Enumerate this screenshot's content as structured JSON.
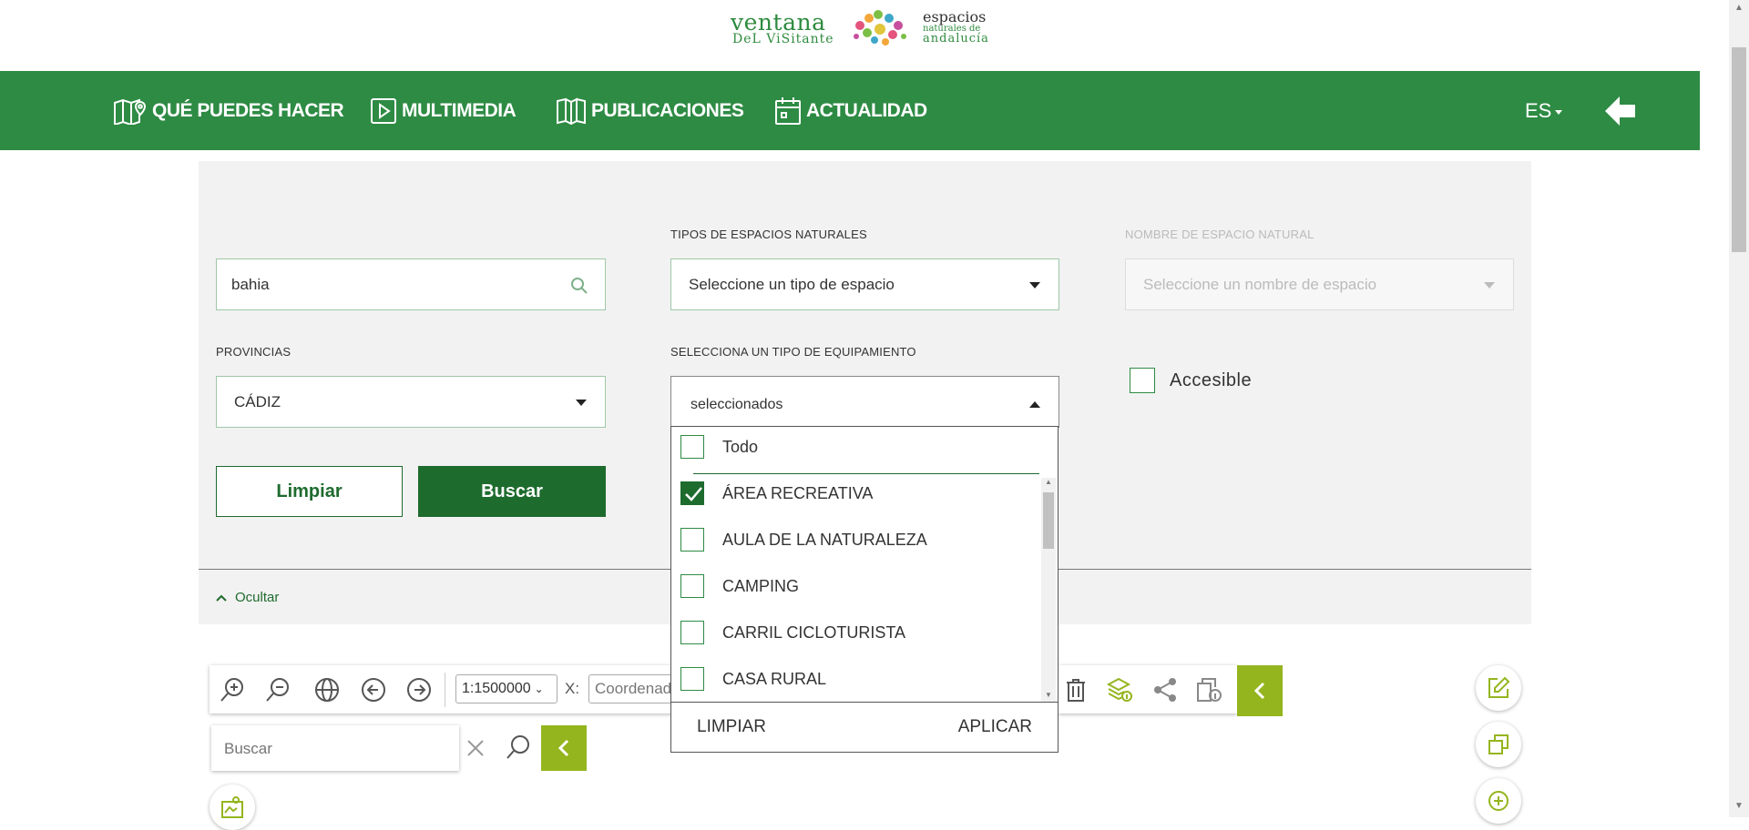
{
  "logo": {
    "left_line1": "ventana",
    "left_line2": "DeL ViSitante",
    "right_line1": "espacios",
    "right_line2": "naturales de",
    "right_line3": "andalucía"
  },
  "nav": {
    "items": [
      {
        "label": "QUÉ PUEDES HACER",
        "icon": "map-pin-icon"
      },
      {
        "label": "MULTIMEDIA",
        "icon": "play-icon"
      },
      {
        "label": "PUBLICACIONES",
        "icon": "book-icon"
      },
      {
        "label": "ACTUALIDAD",
        "icon": "calendar-icon"
      }
    ],
    "language": "ES",
    "back_icon": "arrow-left-icon"
  },
  "filters": {
    "search_value": "bahia",
    "tipos_label": "TIPOS DE ESPACIOS NATURALES",
    "tipos_placeholder": "Seleccione un tipo de espacio",
    "nombre_label": "NOMBRE DE ESPACIO NATURAL",
    "nombre_placeholder": "Seleccione un nombre de espacio",
    "provincias_label": "PROVINCIAS",
    "provincia_value": "CÁDIZ",
    "equipamiento_label": "SELECCIONA UN TIPO DE EQUIPAMIENTO",
    "equipamiento_value": "seleccionados",
    "accesible_label": "Accesible",
    "accesible_checked": false,
    "limpiar_label": "Limpiar",
    "buscar_label": "Buscar",
    "ocultar_label": "Ocultar"
  },
  "dropdown": {
    "todo_label": "Todo",
    "items": [
      {
        "label": "ÁREA RECREATIVA",
        "checked": true
      },
      {
        "label": "AULA DE LA NATURALEZA",
        "checked": false
      },
      {
        "label": "CAMPING",
        "checked": false
      },
      {
        "label": "CARRIL CICLOTURISTA",
        "checked": false
      },
      {
        "label": "CASA RURAL",
        "checked": false
      }
    ],
    "limpiar_label": "LIMPIAR",
    "aplicar_label": "APLICAR"
  },
  "map": {
    "scale_value": "1:1500000",
    "x_label": "X:",
    "coord_placeholder": "Coordenada",
    "search_placeholder": "Buscar"
  },
  "colors": {
    "nav_green": "#2e8b44",
    "dark_green": "#1e6b2e",
    "olive": "#94b51e"
  }
}
